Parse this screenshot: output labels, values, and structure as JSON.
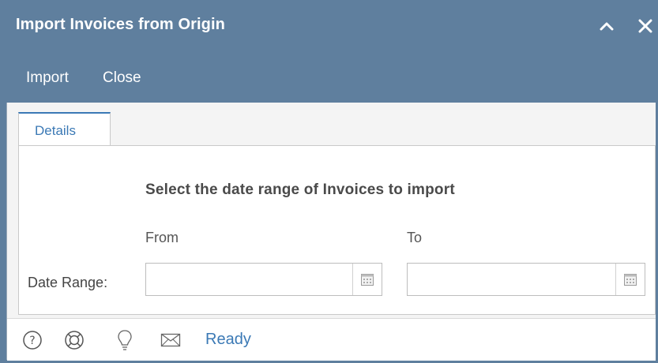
{
  "window": {
    "title": "Import Invoices from Origin",
    "controls": [
      "collapse-icon",
      "close-icon"
    ]
  },
  "toolbar": {
    "import_label": "Import",
    "close_label": "Close"
  },
  "tabs": [
    {
      "label": "Details",
      "active": true
    }
  ],
  "details": {
    "heading": "Select the date range of Invoices to import",
    "from_label": "From",
    "to_label": "To",
    "row_label": "Date Range:",
    "from_value": "",
    "to_value": ""
  },
  "statusbar": {
    "icons": [
      "help-icon",
      "support-icon",
      "tip-icon",
      "mail-icon"
    ],
    "status_text": "Ready"
  },
  "colors": {
    "titlebar": "#5f7f9e",
    "accent": "#3b79b5"
  }
}
